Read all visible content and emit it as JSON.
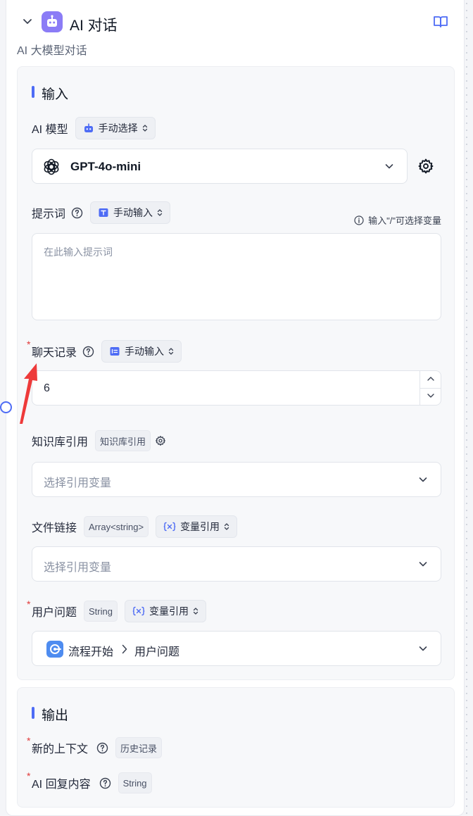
{
  "header": {
    "title": "AI 对话",
    "description": "AI 大模型对话"
  },
  "input_section": {
    "title": "输入",
    "ai_model": {
      "label": "AI 模型",
      "mode": "手动选择",
      "selected_model": "GPT-4o-mini"
    },
    "prompt": {
      "label": "提示词",
      "mode": "手动输入",
      "hint": "输入\"/\"可选择变量",
      "placeholder": "在此输入提示词"
    },
    "chat_history": {
      "label": "聊天记录",
      "mode": "手动输入",
      "value": "6"
    },
    "knowledge": {
      "label": "知识库引用",
      "tag": "知识库引用",
      "placeholder": "选择引用变量"
    },
    "file_link": {
      "label": "文件链接",
      "type_tag": "Array<string>",
      "mode": "变量引用",
      "placeholder": "选择引用变量"
    },
    "user_question": {
      "label": "用户问题",
      "type_tag": "String",
      "mode": "变量引用",
      "source_node": "流程开始",
      "source_field": "用户问题"
    }
  },
  "output_section": {
    "title": "输出",
    "items": [
      {
        "label": "新的上下文",
        "tag": "历史记录"
      },
      {
        "label": "AI 回复内容",
        "tag": "String"
      }
    ]
  },
  "colors": {
    "accent": "#4e6cf5",
    "avatar": "#8b7cf6",
    "required": "#e13a3a",
    "annotation_arrow": "#ee3a3a"
  }
}
